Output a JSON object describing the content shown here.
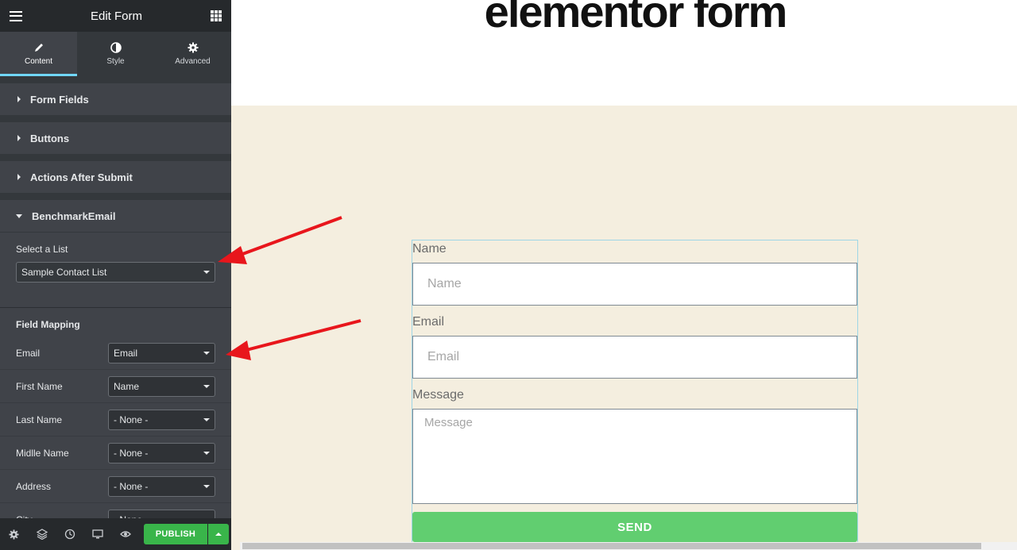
{
  "panel": {
    "title": "Edit Form",
    "tabs": [
      {
        "label": "Content",
        "icon": "pencil-icon"
      },
      {
        "label": "Style",
        "icon": "half-circle-icon"
      },
      {
        "label": "Advanced",
        "icon": "gear-icon"
      }
    ],
    "sections": {
      "form_fields": "Form Fields",
      "buttons": "Buttons",
      "actions_after_submit": "Actions After Submit",
      "benchmark_email": "BenchmarkEmail"
    },
    "select_list": {
      "label": "Select a List",
      "value": "Sample Contact List"
    },
    "field_mapping": {
      "heading": "Field Mapping",
      "rows": [
        {
          "label": "Email",
          "value": "Email"
        },
        {
          "label": "First Name",
          "value": "Name"
        },
        {
          "label": "Last Name",
          "value": "- None -"
        },
        {
          "label": "Midlle Name",
          "value": "- None -"
        },
        {
          "label": "Address",
          "value": "- None -"
        },
        {
          "label": "City",
          "value": "- None -"
        }
      ]
    },
    "footer": {
      "publish_label": "PUBLISH",
      "icons": [
        "settings-icon",
        "layers-icon",
        "history-icon",
        "responsive-icon",
        "preview-icon"
      ]
    }
  },
  "canvas": {
    "heading": "elementor form",
    "form": {
      "name_label": "Name",
      "name_placeholder": "Name",
      "email_label": "Email",
      "email_placeholder": "Email",
      "message_label": "Message",
      "message_placeholder": "Message",
      "send_label": "SEND"
    }
  },
  "colors": {
    "panel_bg": "#34383c",
    "accent_tab": "#71d7f7",
    "publish_green": "#39b54a",
    "send_green": "#61ce70",
    "form_area_bg": "#f4eedf",
    "annotation_arrow": "#e8161c"
  }
}
